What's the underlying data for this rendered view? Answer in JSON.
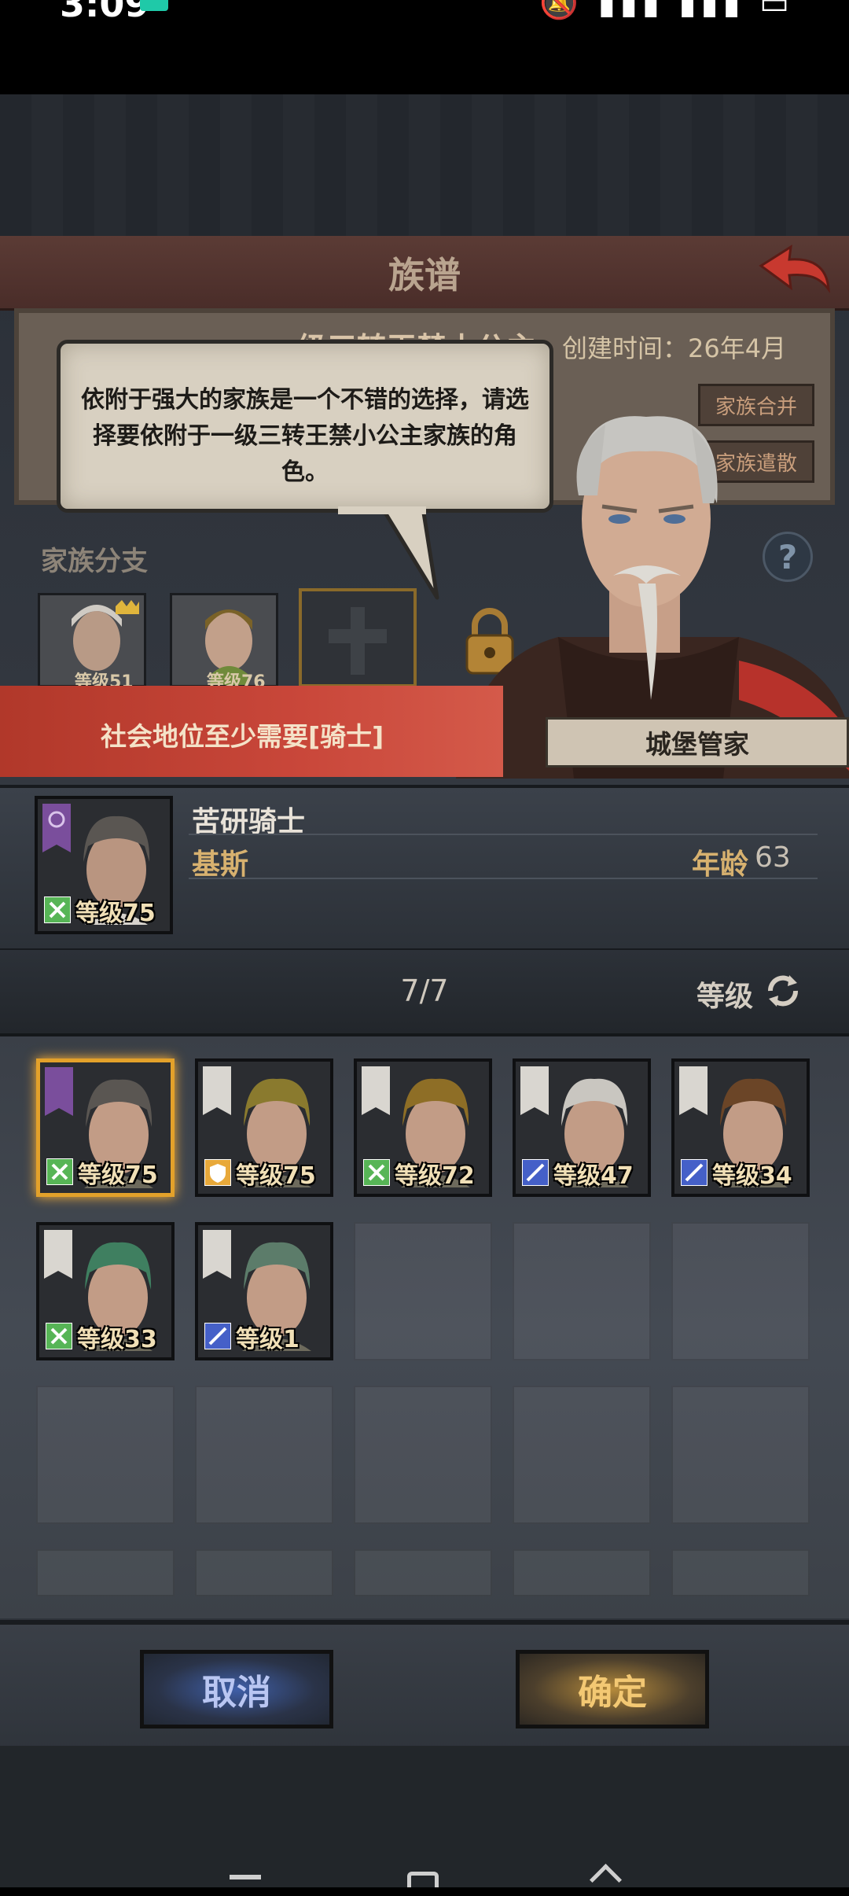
{
  "status_bar": {
    "time": "3:09",
    "icons": "🔕 ▮▮▮ ▮▮▮ ▭"
  },
  "header": {
    "title": "族谱"
  },
  "family": {
    "name": "一级三转王禁小公主",
    "created_time": "创建时间：26年4月",
    "merge_label": "家族合并",
    "dissolve_label": "家族遣散",
    "branch_label": "家族分支",
    "help_label": "?",
    "branch_levels": [
      "等级51",
      "等级76"
    ]
  },
  "dialog": {
    "message": "依附于强大的家族是一个不错的选择，请选择要依附于一级三转王禁小公主家族的角色。",
    "speaker": "城堡管家"
  },
  "requirement": {
    "text": "社会地位至少需要[骑士]"
  },
  "selected": {
    "title": "苦研骑士",
    "name": "基斯",
    "age_label": "年龄",
    "age": "63",
    "level": "等级75"
  },
  "list": {
    "count": "7/7",
    "sort_label": "等级",
    "characters": [
      {
        "level": "等级75",
        "badge": "green",
        "selected": true,
        "hair": "#5a5652",
        "flag": "purple"
      },
      {
        "level": "等级75",
        "badge": "orange",
        "selected": false,
        "hair": "#8a7a2e",
        "flag": "white"
      },
      {
        "level": "等级72",
        "badge": "green",
        "selected": false,
        "hair": "#8e6e26",
        "flag": "white"
      },
      {
        "level": "等级47",
        "badge": "blue",
        "selected": false,
        "hair": "#c9c6c0",
        "flag": "white"
      },
      {
        "level": "等级34",
        "badge": "blue",
        "selected": false,
        "hair": "#6b4527",
        "flag": "white"
      },
      {
        "level": "等级33",
        "badge": "green",
        "selected": false,
        "hair": "#3f7f60",
        "flag": "white"
      },
      {
        "level": "等级1",
        "badge": "blue",
        "selected": false,
        "hair": "#5c7c6a",
        "flag": "white"
      }
    ]
  },
  "buttons": {
    "cancel": "取消",
    "confirm": "确定"
  },
  "colors": {
    "badge_green": "#57b556",
    "badge_orange": "#e8a93a",
    "badge_blue": "#4560c8",
    "accent_gold": "#e3a12a",
    "banner_red": "#c9473a"
  }
}
